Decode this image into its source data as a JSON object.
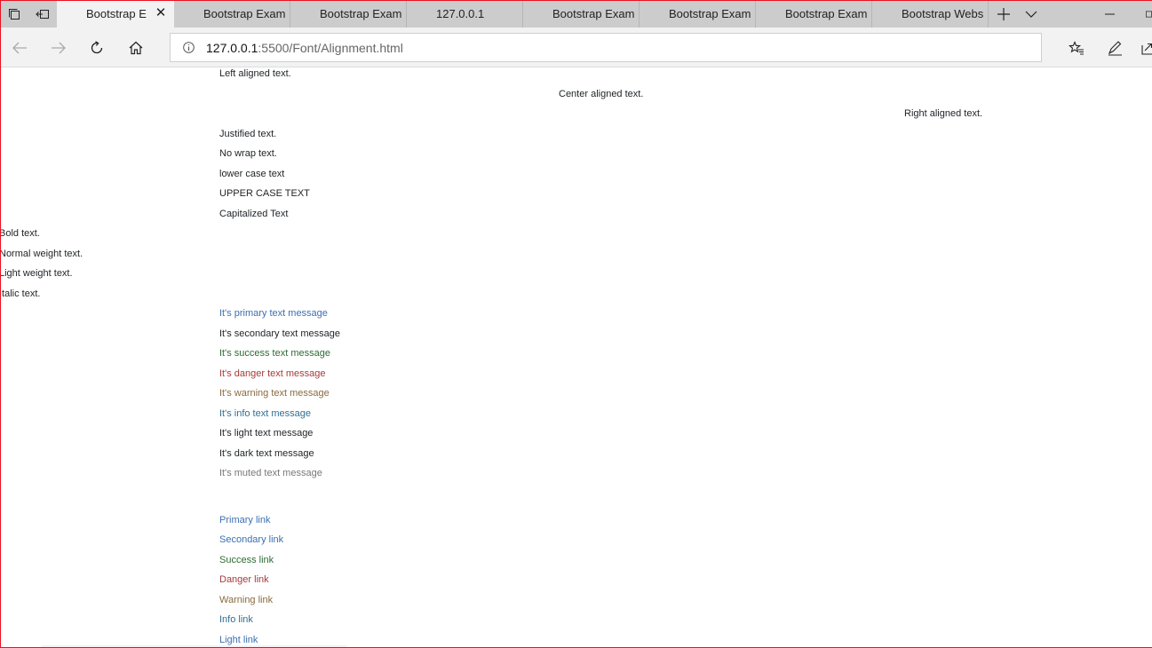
{
  "browser": {
    "tabs": [
      {
        "label": "Bootstrap E",
        "active": true
      },
      {
        "label": "Bootstrap Exam",
        "active": false
      },
      {
        "label": "Bootstrap Exam",
        "active": false
      },
      {
        "label": "127.0.0.1",
        "active": false
      },
      {
        "label": "Bootstrap Exam",
        "active": false
      },
      {
        "label": "Bootstrap Exam",
        "active": false
      },
      {
        "label": "Bootstrap Exam",
        "active": false
      },
      {
        "label": "Bootstrap Webs",
        "active": false
      }
    ],
    "address": {
      "host": "127.0.0.1",
      "rest": ":5500/Font/Alignment.html"
    },
    "icons": {
      "tab_manager": "tab-manager-icon",
      "set_aside": "set-aside-tabs-icon",
      "close_tab": "close-icon",
      "new_tab": "plus-icon",
      "tab_list": "chevron-down-icon",
      "back": "back-arrow-icon",
      "forward": "forward-arrow-icon",
      "refresh": "refresh-icon",
      "home": "home-icon",
      "site_info": "info-icon",
      "favorites": "favorites-icon",
      "notes": "pen-icon",
      "share": "share-icon",
      "minimize": "minimize-icon",
      "restore": "restore-icon"
    }
  },
  "content": {
    "alignment": {
      "left": "Left aligned text.",
      "center": "Center aligned text.",
      "right": "Right aligned text.",
      "justify": "Justified text.",
      "nowrap": "No wrap text."
    },
    "transform": {
      "lower": "lower case text",
      "upper": "UPPER CASE TEXT",
      "capitalized": "Capitalized Text"
    },
    "weight": {
      "bold": "Bold text.",
      "normal": "Normal weight text.",
      "light": "Light weight text.",
      "italic": "Italic text."
    },
    "text_colors": [
      {
        "label": "It's primary text message",
        "color": "#3c6fb0"
      },
      {
        "label": "It's secondary text message",
        "color": "#212529"
      },
      {
        "label": "It's success text message",
        "color": "#2e6b32"
      },
      {
        "label": "It's danger text message",
        "color": "#a63a3a"
      },
      {
        "label": "It's warning text message",
        "color": "#8a6a3d"
      },
      {
        "label": "It's info text message",
        "color": "#2f6f95"
      },
      {
        "label": "It's light text message",
        "color": "#212529"
      },
      {
        "label": "It's dark text message",
        "color": "#212529"
      },
      {
        "label": "It's muted text message",
        "color": "#777777"
      }
    ],
    "links": [
      {
        "label": "Primary link",
        "color": "#3c6fb0"
      },
      {
        "label": "Secondary link",
        "color": "#3c6fb0"
      },
      {
        "label": "Success link",
        "color": "#2e6b32"
      },
      {
        "label": "Danger link",
        "color": "#a63a3a"
      },
      {
        "label": "Warning link",
        "color": "#8a6a3d"
      },
      {
        "label": "Info link",
        "color": "#2f6f95"
      },
      {
        "label": "Light link",
        "color": "#3c6fb0"
      }
    ]
  }
}
